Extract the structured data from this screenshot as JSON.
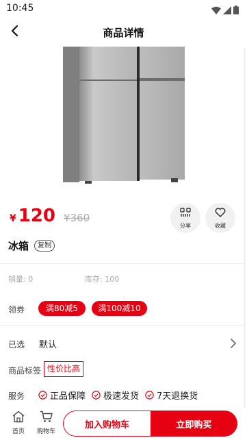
{
  "status_bar": {
    "time": "10:45"
  },
  "header": {
    "title": "商品详情"
  },
  "product": {
    "currency": "¥",
    "price": "120",
    "original_price": "¥360",
    "name": "冰箱",
    "copy_label": "复制",
    "sales": "销量: 0",
    "stock": "库存: 100",
    "image_carousel": {
      "slide_count": 1,
      "active_index": 0
    }
  },
  "actions": {
    "share_label": "分享",
    "favorite_label": "收藏"
  },
  "coupons": {
    "label": "领券",
    "items": [
      "满80减5",
      "满100减10"
    ]
  },
  "selection": {
    "label": "已选",
    "value": "默认"
  },
  "tags": {
    "label": "商品标签",
    "items": [
      "性价比高"
    ]
  },
  "services": {
    "label": "服务",
    "items": [
      "正品保障",
      "极速发货",
      "7天退换货"
    ]
  },
  "bottom_bar": {
    "home_label": "首页",
    "cart_label": "购物车",
    "add_to_cart_label": "加入购物车",
    "buy_now_label": "立即购买"
  },
  "colors": {
    "accent": "#e60012",
    "muted_text": "#aaaaaa",
    "circle_bg": "#f1f1f1"
  }
}
